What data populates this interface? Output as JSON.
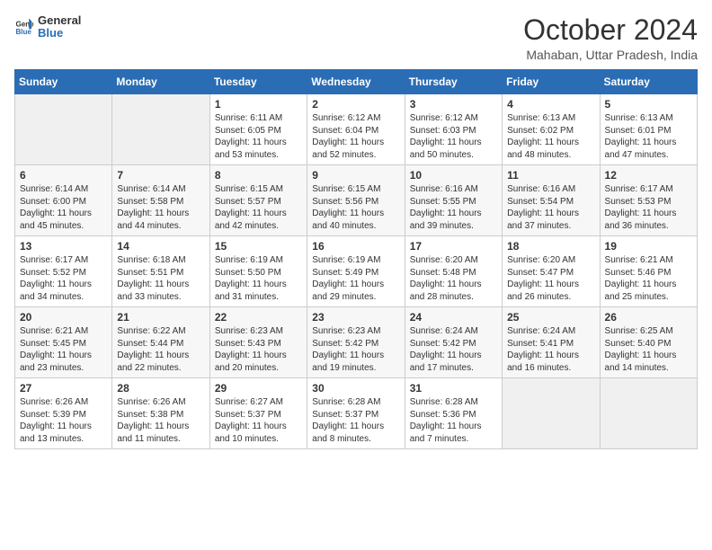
{
  "header": {
    "logo_general": "General",
    "logo_blue": "Blue",
    "month": "October 2024",
    "location": "Mahaban, Uttar Pradesh, India"
  },
  "columns": [
    "Sunday",
    "Monday",
    "Tuesday",
    "Wednesday",
    "Thursday",
    "Friday",
    "Saturday"
  ],
  "weeks": [
    [
      {
        "day": "",
        "text": ""
      },
      {
        "day": "",
        "text": ""
      },
      {
        "day": "1",
        "text": "Sunrise: 6:11 AM\nSunset: 6:05 PM\nDaylight: 11 hours and 53 minutes."
      },
      {
        "day": "2",
        "text": "Sunrise: 6:12 AM\nSunset: 6:04 PM\nDaylight: 11 hours and 52 minutes."
      },
      {
        "day": "3",
        "text": "Sunrise: 6:12 AM\nSunset: 6:03 PM\nDaylight: 11 hours and 50 minutes."
      },
      {
        "day": "4",
        "text": "Sunrise: 6:13 AM\nSunset: 6:02 PM\nDaylight: 11 hours and 48 minutes."
      },
      {
        "day": "5",
        "text": "Sunrise: 6:13 AM\nSunset: 6:01 PM\nDaylight: 11 hours and 47 minutes."
      }
    ],
    [
      {
        "day": "6",
        "text": "Sunrise: 6:14 AM\nSunset: 6:00 PM\nDaylight: 11 hours and 45 minutes."
      },
      {
        "day": "7",
        "text": "Sunrise: 6:14 AM\nSunset: 5:58 PM\nDaylight: 11 hours and 44 minutes."
      },
      {
        "day": "8",
        "text": "Sunrise: 6:15 AM\nSunset: 5:57 PM\nDaylight: 11 hours and 42 minutes."
      },
      {
        "day": "9",
        "text": "Sunrise: 6:15 AM\nSunset: 5:56 PM\nDaylight: 11 hours and 40 minutes."
      },
      {
        "day": "10",
        "text": "Sunrise: 6:16 AM\nSunset: 5:55 PM\nDaylight: 11 hours and 39 minutes."
      },
      {
        "day": "11",
        "text": "Sunrise: 6:16 AM\nSunset: 5:54 PM\nDaylight: 11 hours and 37 minutes."
      },
      {
        "day": "12",
        "text": "Sunrise: 6:17 AM\nSunset: 5:53 PM\nDaylight: 11 hours and 36 minutes."
      }
    ],
    [
      {
        "day": "13",
        "text": "Sunrise: 6:17 AM\nSunset: 5:52 PM\nDaylight: 11 hours and 34 minutes."
      },
      {
        "day": "14",
        "text": "Sunrise: 6:18 AM\nSunset: 5:51 PM\nDaylight: 11 hours and 33 minutes."
      },
      {
        "day": "15",
        "text": "Sunrise: 6:19 AM\nSunset: 5:50 PM\nDaylight: 11 hours and 31 minutes."
      },
      {
        "day": "16",
        "text": "Sunrise: 6:19 AM\nSunset: 5:49 PM\nDaylight: 11 hours and 29 minutes."
      },
      {
        "day": "17",
        "text": "Sunrise: 6:20 AM\nSunset: 5:48 PM\nDaylight: 11 hours and 28 minutes."
      },
      {
        "day": "18",
        "text": "Sunrise: 6:20 AM\nSunset: 5:47 PM\nDaylight: 11 hours and 26 minutes."
      },
      {
        "day": "19",
        "text": "Sunrise: 6:21 AM\nSunset: 5:46 PM\nDaylight: 11 hours and 25 minutes."
      }
    ],
    [
      {
        "day": "20",
        "text": "Sunrise: 6:21 AM\nSunset: 5:45 PM\nDaylight: 11 hours and 23 minutes."
      },
      {
        "day": "21",
        "text": "Sunrise: 6:22 AM\nSunset: 5:44 PM\nDaylight: 11 hours and 22 minutes."
      },
      {
        "day": "22",
        "text": "Sunrise: 6:23 AM\nSunset: 5:43 PM\nDaylight: 11 hours and 20 minutes."
      },
      {
        "day": "23",
        "text": "Sunrise: 6:23 AM\nSunset: 5:42 PM\nDaylight: 11 hours and 19 minutes."
      },
      {
        "day": "24",
        "text": "Sunrise: 6:24 AM\nSunset: 5:42 PM\nDaylight: 11 hours and 17 minutes."
      },
      {
        "day": "25",
        "text": "Sunrise: 6:24 AM\nSunset: 5:41 PM\nDaylight: 11 hours and 16 minutes."
      },
      {
        "day": "26",
        "text": "Sunrise: 6:25 AM\nSunset: 5:40 PM\nDaylight: 11 hours and 14 minutes."
      }
    ],
    [
      {
        "day": "27",
        "text": "Sunrise: 6:26 AM\nSunset: 5:39 PM\nDaylight: 11 hours and 13 minutes."
      },
      {
        "day": "28",
        "text": "Sunrise: 6:26 AM\nSunset: 5:38 PM\nDaylight: 11 hours and 11 minutes."
      },
      {
        "day": "29",
        "text": "Sunrise: 6:27 AM\nSunset: 5:37 PM\nDaylight: 11 hours and 10 minutes."
      },
      {
        "day": "30",
        "text": "Sunrise: 6:28 AM\nSunset: 5:37 PM\nDaylight: 11 hours and 8 minutes."
      },
      {
        "day": "31",
        "text": "Sunrise: 6:28 AM\nSunset: 5:36 PM\nDaylight: 11 hours and 7 minutes."
      },
      {
        "day": "",
        "text": ""
      },
      {
        "day": "",
        "text": ""
      }
    ]
  ]
}
